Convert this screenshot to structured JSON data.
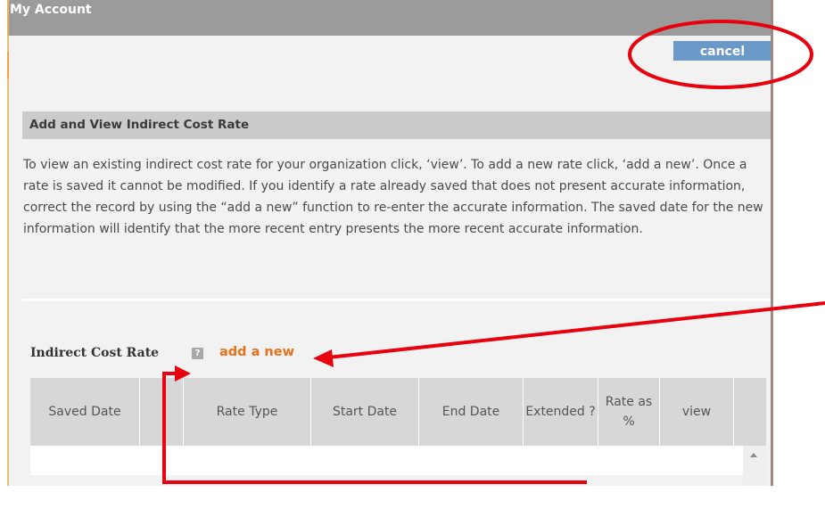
{
  "window": {
    "title": "My Account"
  },
  "toolbar": {
    "cancel_label": "cancel"
  },
  "section": {
    "header": "Add and View Indirect Cost Rate",
    "description": "To view an existing indirect cost rate for your organization click, ‘view’. To add a new rate click, ‘add a new’. Once a rate is saved it cannot be modified. If you identify a rate already saved that does not present accurate information, correct the record by using the “add a new” function to re-enter the accurate information. The saved date for the new information will identify that the more recent entry presents the more recent accurate information."
  },
  "rates": {
    "label": "Indirect Cost Rate",
    "help_icon": "?",
    "add_link": "add a new",
    "columns": [
      "Saved Date",
      "",
      "Rate Type",
      "Start Date",
      "End Date",
      "Extended ?",
      "Rate as %",
      "view",
      ""
    ]
  },
  "icons": {
    "help": "help-icon",
    "scroll_up": "chevron-up-icon"
  },
  "annotation_colors": {
    "red": "#e8000d"
  }
}
